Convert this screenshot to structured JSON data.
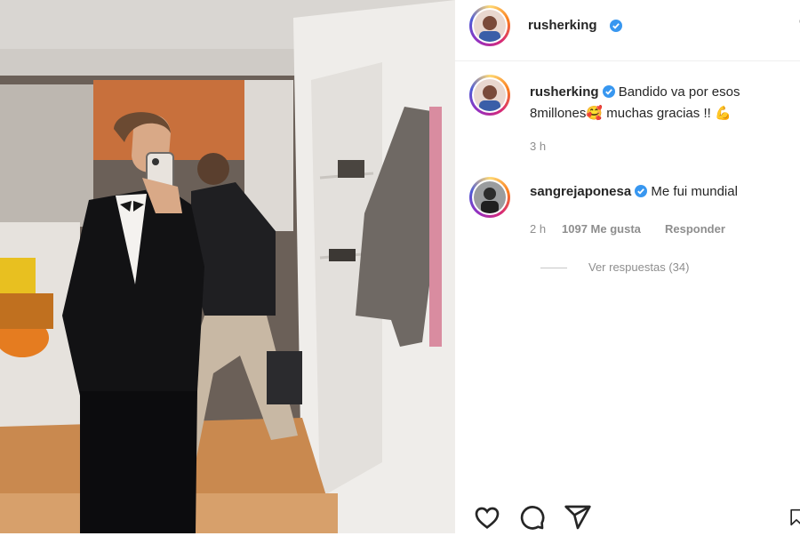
{
  "post": {
    "author": "rusherking",
    "verified": true
  },
  "caption": {
    "username": "rusherking",
    "text_part1": "Bandido va por esos 8millones",
    "emoji1": "🥰",
    "text_part2": "muchas gracias !!",
    "emoji2": "💪",
    "time": "3 h"
  },
  "comment": {
    "username": "sangrejaponesa",
    "text": "Me fui mundial",
    "time": "2 h",
    "likes": "1097 Me gusta",
    "reply_label": "Responder",
    "view_replies": "Ver respuestas (34)"
  },
  "icons": {
    "more": "more-options-icon",
    "like": "heart-icon",
    "comment": "comment-icon",
    "share": "share-icon",
    "save": "bookmark-icon",
    "verified": "verified-badge-icon"
  },
  "colors": {
    "verified_blue": "#3897f0",
    "muted_text": "#8e8e8e"
  }
}
